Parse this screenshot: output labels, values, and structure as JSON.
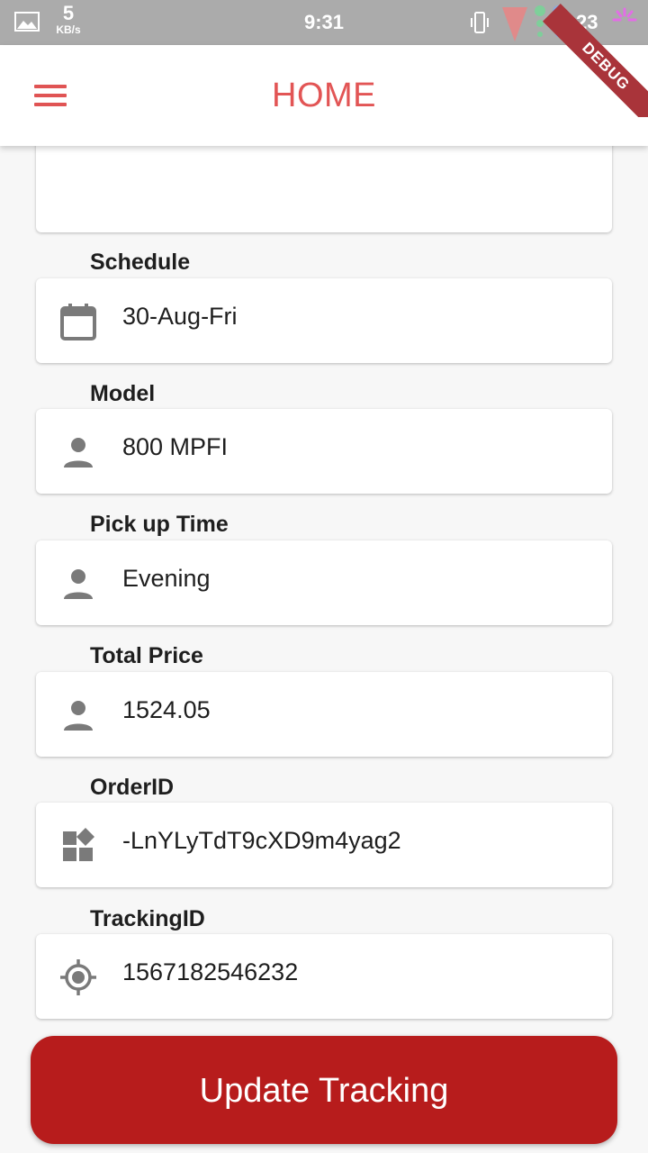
{
  "status_bar": {
    "net_speed_value": "5",
    "net_speed_unit": "KB/s",
    "time": "9:31",
    "battery": "23",
    "icons": [
      "gallery-icon",
      "vibrate-icon",
      "signal-icon",
      "battery-icon",
      "sync-icon"
    ]
  },
  "app_bar": {
    "title": "HOME",
    "debug_banner": "DEBUG",
    "accent_color": "#e25555"
  },
  "fields": [
    {
      "label": "Schedule",
      "value": "30-Aug-Fri",
      "icon": "calendar-icon"
    },
    {
      "label": "Model",
      "value": "800 MPFI",
      "icon": "person-icon"
    },
    {
      "label": "Pick up Time",
      "value": "Evening",
      "icon": "person-icon"
    },
    {
      "label": "Total Price",
      "value": "1524.05",
      "icon": "person-icon"
    },
    {
      "label": "OrderID",
      "value": "-LnYLyTdT9cXD9m4yag2",
      "icon": "widgets-icon"
    },
    {
      "label": "TrackingID",
      "value": "1567182546232",
      "icon": "gps-target-icon"
    }
  ],
  "actions": {
    "update_tracking": "Update Tracking",
    "button_color": "#b71c1c"
  }
}
